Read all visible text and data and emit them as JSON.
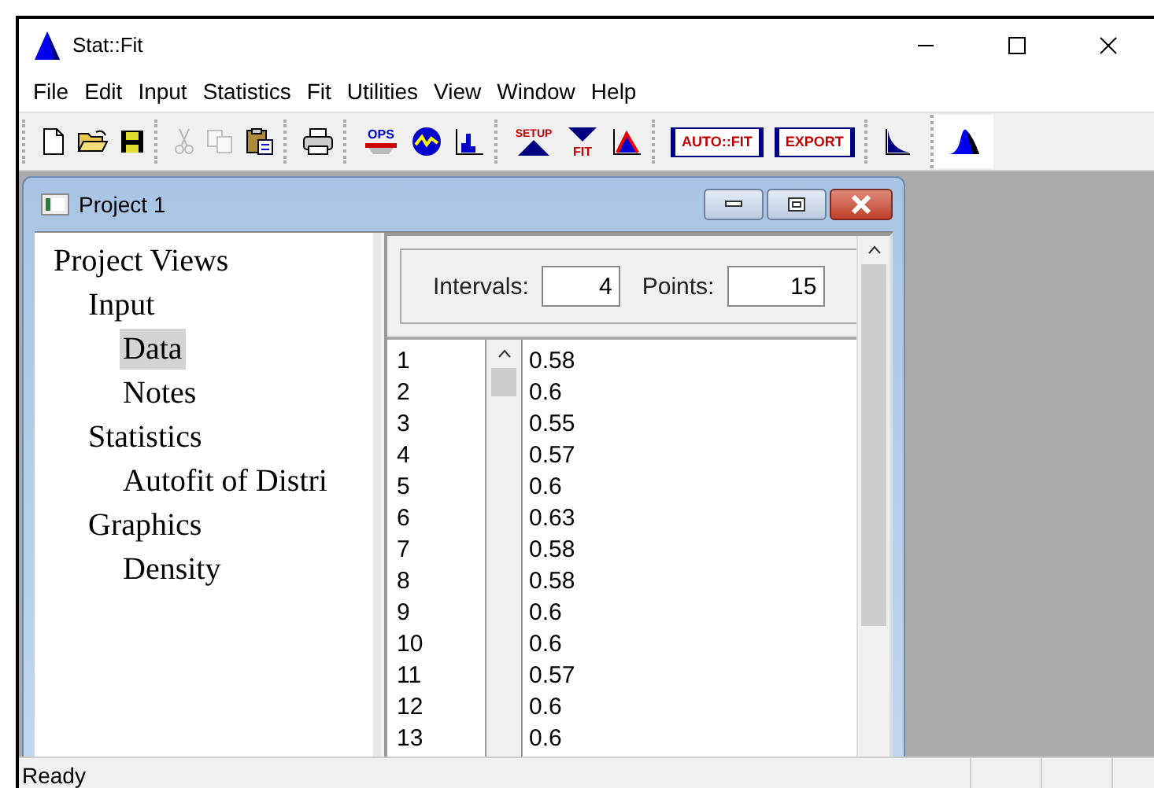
{
  "window": {
    "title": "Stat::Fit"
  },
  "menu": [
    "File",
    "Edit",
    "Input",
    "Statistics",
    "Fit",
    "Utilities",
    "View",
    "Window",
    "Help"
  ],
  "toolbar": {
    "groups": [
      [
        {
          "kind": "new",
          "disabled": false
        },
        {
          "kind": "open",
          "disabled": false
        },
        {
          "kind": "save",
          "disabled": false
        }
      ],
      [
        {
          "kind": "cut",
          "disabled": true
        },
        {
          "kind": "copy",
          "disabled": true
        },
        {
          "kind": "paste",
          "disabled": false
        }
      ],
      [
        {
          "kind": "print",
          "disabled": false
        }
      ],
      [
        {
          "kind": "ops",
          "label": "OPS",
          "disabled": false
        },
        {
          "kind": "stats",
          "disabled": false
        },
        {
          "kind": "histogram",
          "disabled": false
        }
      ],
      [
        {
          "kind": "setup",
          "label": "SETUP",
          "disabled": false
        },
        {
          "kind": "fit",
          "label": "FIT",
          "disabled": false
        },
        {
          "kind": "graph",
          "disabled": false
        }
      ],
      [
        {
          "kind": "textbutton",
          "label": "AUTO::FIT",
          "disabled": false
        },
        {
          "kind": "textbutton",
          "label": "EXPORT",
          "disabled": false
        }
      ],
      [
        {
          "kind": "curve",
          "disabled": false
        }
      ],
      [
        {
          "kind": "density",
          "disabled": false
        }
      ]
    ]
  },
  "project": {
    "title": "Project 1",
    "tree": [
      {
        "label": "Project Views",
        "selected": false,
        "children": [
          {
            "label": "Input",
            "selected": false,
            "children": [
              {
                "label": "Data",
                "selected": true
              },
              {
                "label": "Notes",
                "selected": false
              }
            ]
          },
          {
            "label": "Statistics",
            "selected": false,
            "children": [
              {
                "label": "Autofit of Distri",
                "selected": false
              }
            ]
          },
          {
            "label": "Graphics",
            "selected": false,
            "children": [
              {
                "label": "Density",
                "selected": false
              }
            ]
          }
        ]
      }
    ],
    "fields": [
      {
        "label": "Intervals:",
        "value": "4"
      },
      {
        "label": "Points:",
        "value": "15"
      }
    ],
    "rows": [
      {
        "index": "1",
        "value": "0.58"
      },
      {
        "index": "2",
        "value": "0.6"
      },
      {
        "index": "3",
        "value": "0.55"
      },
      {
        "index": "4",
        "value": "0.57"
      },
      {
        "index": "5",
        "value": "0.6"
      },
      {
        "index": "6",
        "value": "0.63"
      },
      {
        "index": "7",
        "value": "0.58"
      },
      {
        "index": "8",
        "value": "0.58"
      },
      {
        "index": "9",
        "value": "0.6"
      },
      {
        "index": "10",
        "value": "0.6"
      },
      {
        "index": "11",
        "value": "0.57"
      },
      {
        "index": "12",
        "value": "0.6"
      },
      {
        "index": "13",
        "value": "0.6"
      }
    ]
  },
  "status_bar": {
    "text": "Ready"
  }
}
